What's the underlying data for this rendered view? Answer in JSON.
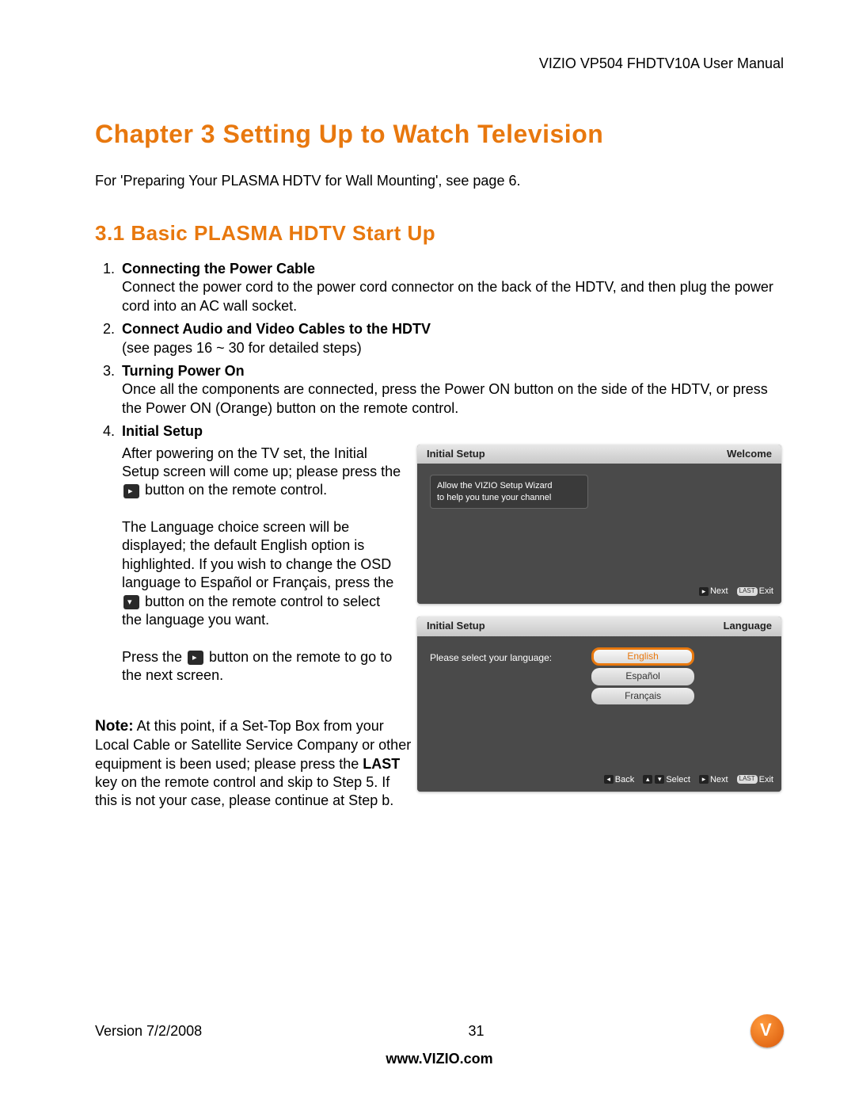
{
  "header": {
    "doc_title": "VIZIO VP504 FHDTV10A User Manual"
  },
  "chapter": {
    "title": "Chapter 3 Setting Up to Watch Television"
  },
  "intro": "For 'Preparing Your PLASMA HDTV for Wall Mounting', see page 6.",
  "section": {
    "title": "3.1 Basic PLASMA HDTV Start Up"
  },
  "steps": {
    "s1": {
      "num": "1.",
      "title": "Connecting the Power Cable",
      "body": "Connect the power cord to the power cord connector on the back of the HDTV, and then plug the power cord into an AC wall socket."
    },
    "s2": {
      "num": "2.",
      "title": "Connect Audio and Video Cables to the HDTV",
      "body": "(see pages 16 ~ 30 for detailed steps)"
    },
    "s3": {
      "num": "3.",
      "title": "Turning Power On",
      "body": "Once all the components are connected, press the Power ON button on the side of the HDTV, or press the Power ON (Orange) button on the remote control."
    },
    "s4": {
      "num": "4.",
      "title": "Initial Setup",
      "p1a": "After powering on the TV set, the Initial Setup screen will come up; please press the ",
      "p1b": " button on the remote control.",
      "p2a": "The Language choice screen will be displayed; the default English option is highlighted.  If you wish to change the OSD language to Español or Français, press the ",
      "p2b": " button on the remote control to select the language you want.",
      "p3a": "Press the ",
      "p3b": " button on the remote to go to the next screen."
    }
  },
  "note": {
    "label": "Note:",
    "text_a": "  At this point, if a Set-Top Box from your Local Cable or Satellite Service Company or other equipment is been used; please press the ",
    "last": "LAST",
    "text_b": " key on the remote control and skip to Step 5. If this is not your case, please continue at Step b."
  },
  "tv1": {
    "header_left": "Initial Setup",
    "header_right": "Welcome",
    "wizard_l1": "Allow the VIZIO Setup Wizard",
    "wizard_l2": "to help you tune your channel",
    "next": "Next",
    "exit": "Exit",
    "exit_key": "LAST"
  },
  "tv2": {
    "header_left": "Initial Setup",
    "header_right": "Language",
    "prompt": "Please select your language:",
    "opt1": "English",
    "opt2": "Español",
    "opt3": "Français",
    "back": "Back",
    "select": "Select",
    "next": "Next",
    "exit": "Exit",
    "exit_key": "LAST"
  },
  "footer": {
    "version": "Version 7/2/2008",
    "page": "31",
    "url": "www.VIZIO.com"
  }
}
